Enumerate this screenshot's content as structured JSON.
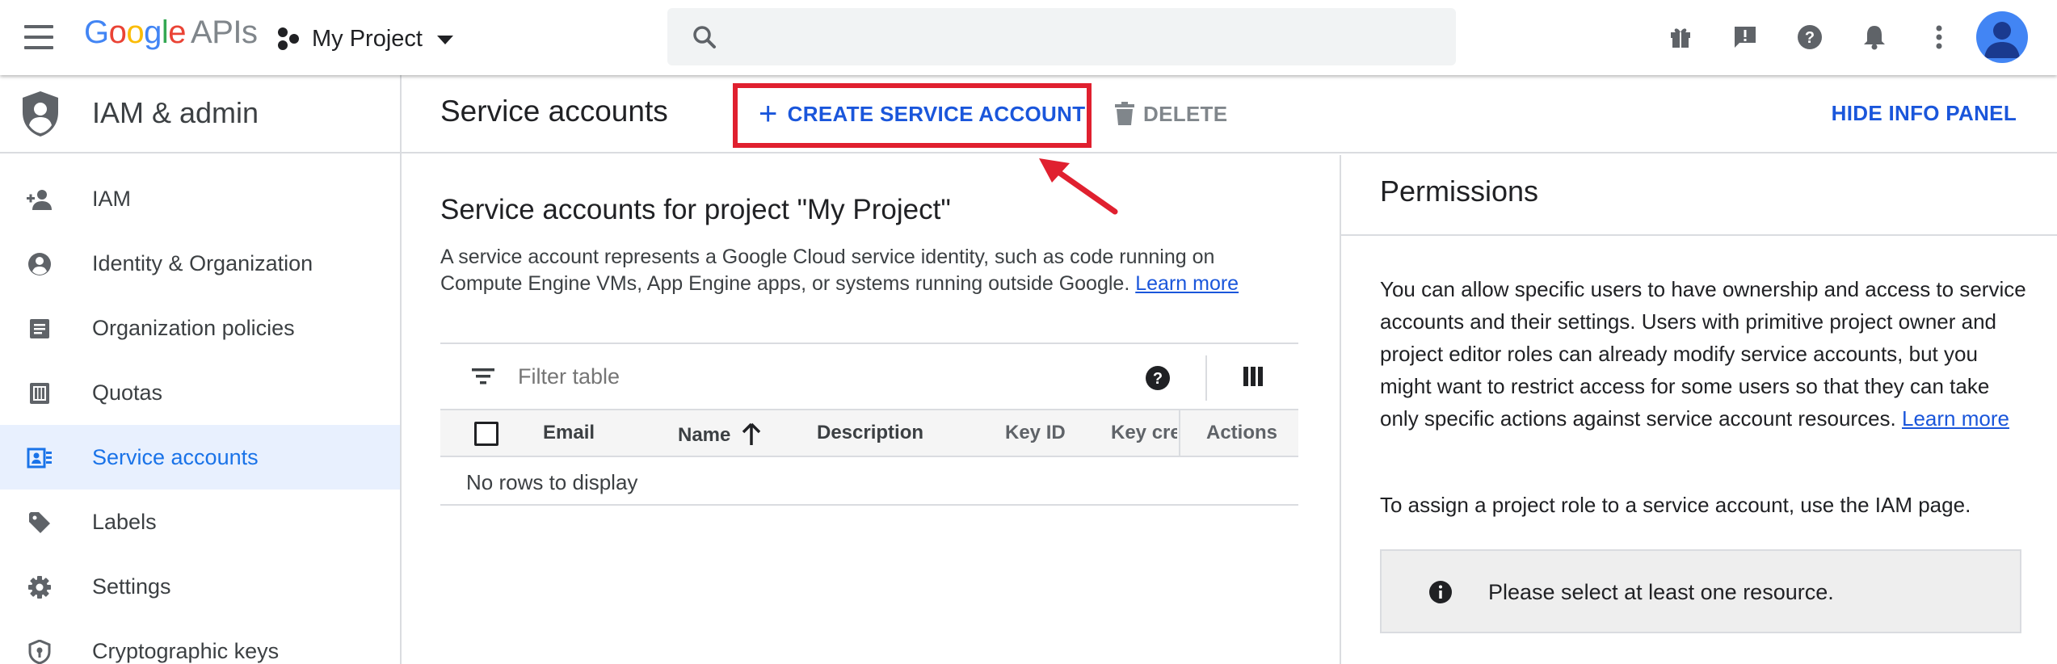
{
  "topbar": {
    "logo": {
      "g": "G",
      "o1": "o",
      "o2": "o",
      "g2": "g",
      "l": "l",
      "e": "e",
      "apis": "APIs"
    },
    "project_name": "My Project",
    "search_placeholder": ""
  },
  "sidebar": {
    "title": "IAM & admin",
    "items": [
      {
        "label": "IAM",
        "icon": "person-add-icon"
      },
      {
        "label": "Identity & Organization",
        "icon": "account-circle-icon"
      },
      {
        "label": "Organization policies",
        "icon": "document-icon"
      },
      {
        "label": "Quotas",
        "icon": "quota-icon"
      },
      {
        "label": "Service accounts",
        "icon": "service-account-icon",
        "active": true
      },
      {
        "label": "Labels",
        "icon": "label-icon"
      },
      {
        "label": "Settings",
        "icon": "gear-icon"
      },
      {
        "label": "Cryptographic keys",
        "icon": "key-shield-icon"
      }
    ]
  },
  "header": {
    "title": "Service accounts",
    "create_label": "CREATE SERVICE ACCOUNT",
    "delete_label": "DELETE",
    "hide_info_label": "HIDE INFO PANEL"
  },
  "content": {
    "section_title": "Service accounts for project \"My Project\"",
    "description": "A service account represents a Google Cloud service identity, such as code running on Compute Engine VMs, App Engine apps, or systems running outside Google.",
    "learn_more": "Learn more",
    "filter_placeholder": "Filter table",
    "columns": [
      "Email",
      "Name",
      "Description",
      "Key ID",
      "Key creation date",
      "Actions"
    ],
    "empty_text": "No rows to display"
  },
  "info_panel": {
    "title": "Permissions",
    "text": "You can allow specific users to have ownership and access to service accounts and their settings. Users with primitive project owner and project editor roles can already modify service accounts, but you might want to restrict access for some users so that they can take only specific actions against service account resources.",
    "learn_more": "Learn more",
    "text2": "To assign a project role to a service account, use the IAM page.",
    "notice": "Please select at least one resource."
  },
  "colors": {
    "accent": "#1a56db",
    "highlight_box": "#e0202f",
    "active_bg": "#e8f0fe"
  }
}
